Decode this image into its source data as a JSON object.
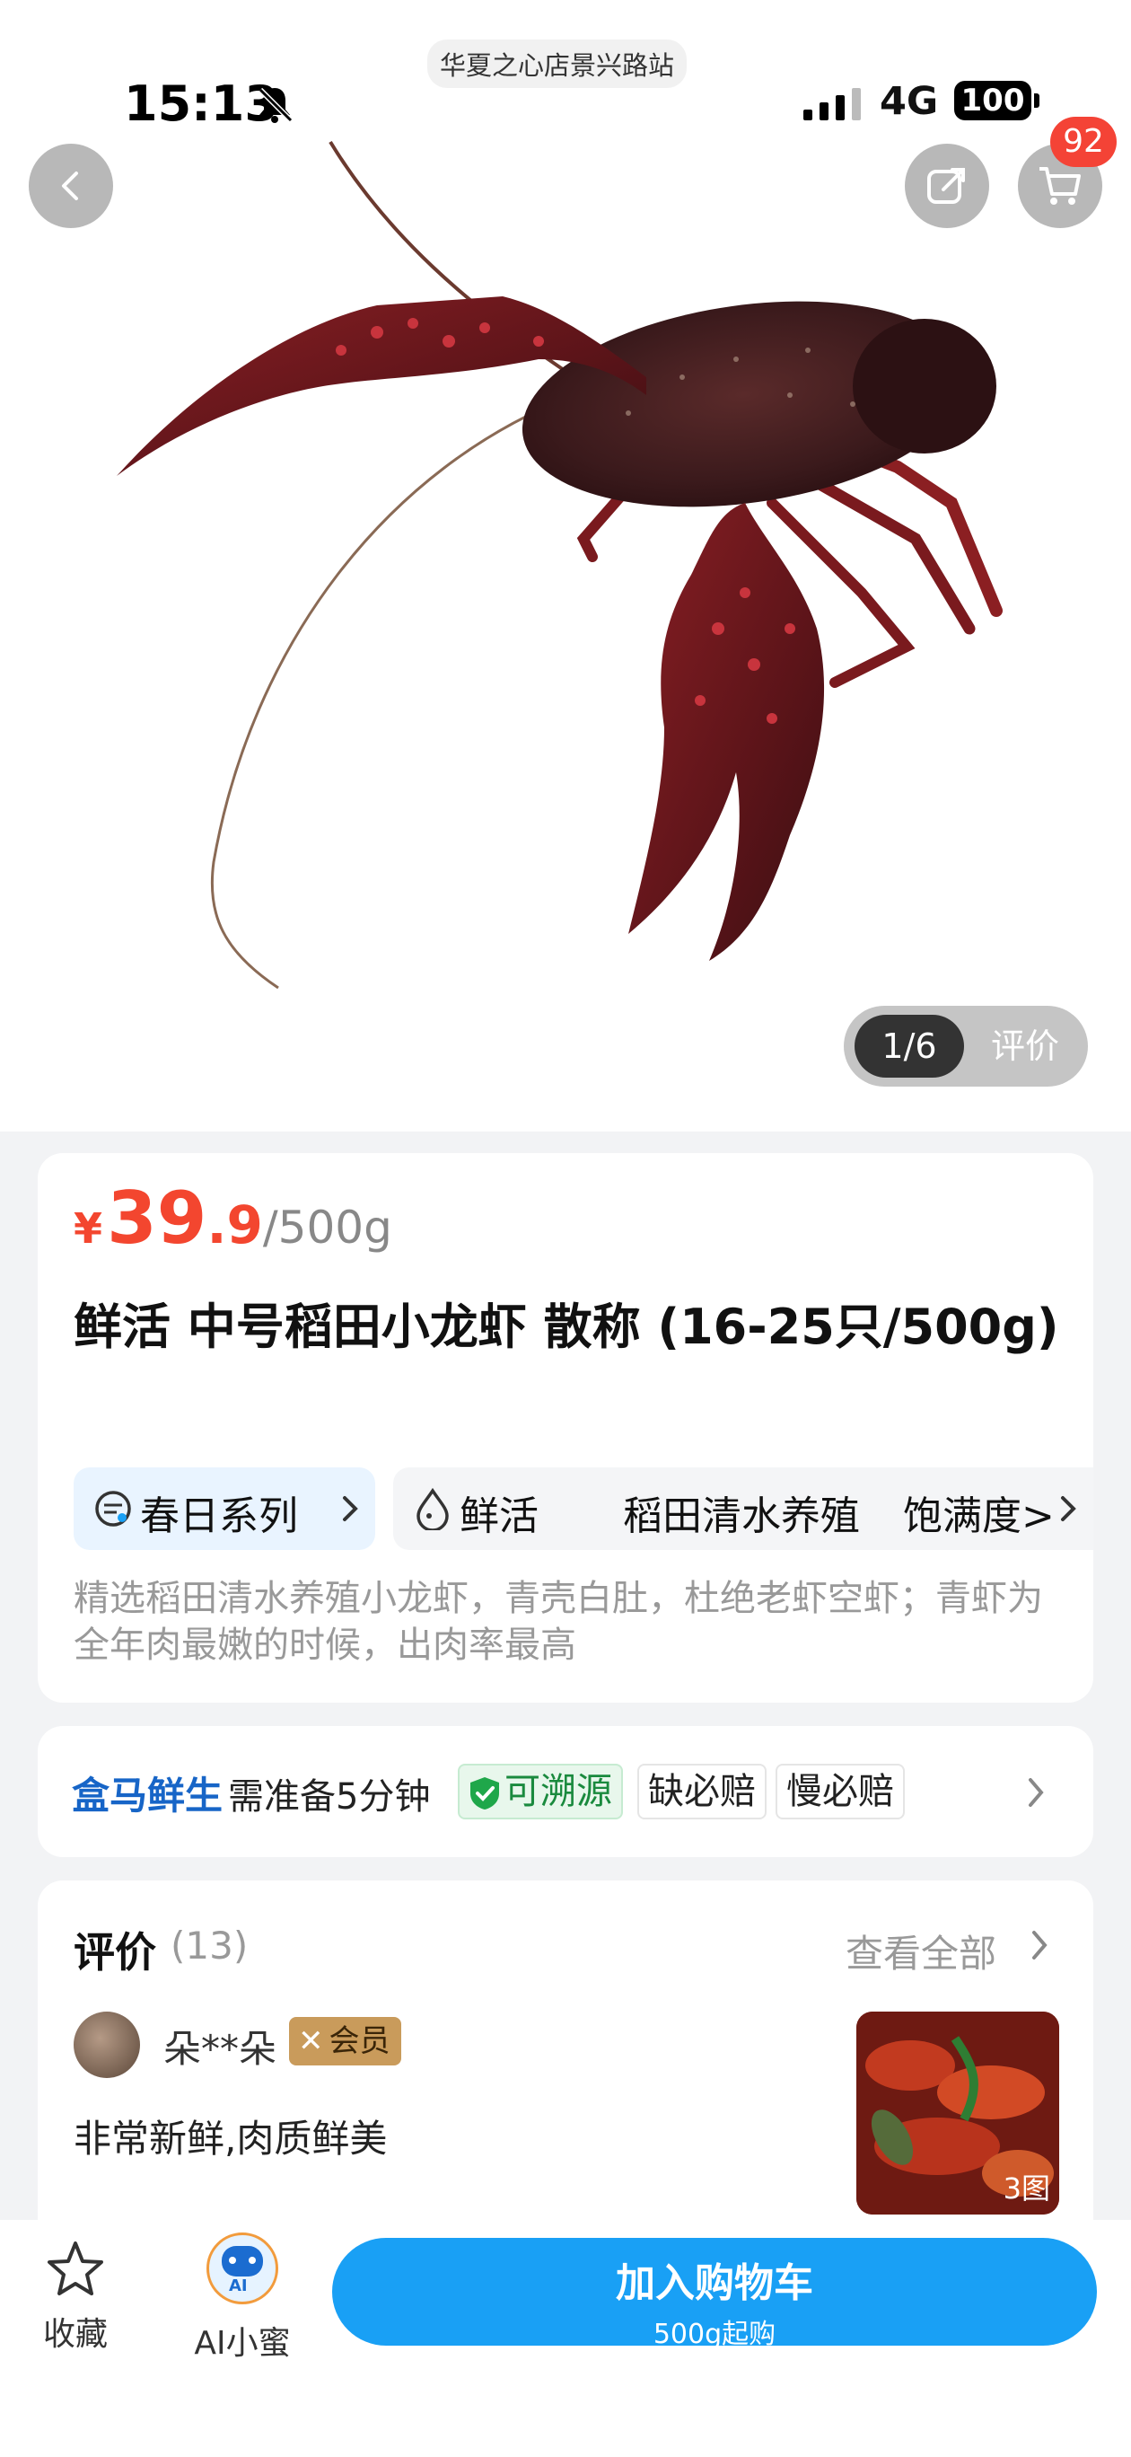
{
  "status_bar": {
    "time": "15:13",
    "network": "4G",
    "battery": "100"
  },
  "store": {
    "name": "华夏之心店景兴路站"
  },
  "header": {
    "cart_count": "92"
  },
  "gallery": {
    "index": "1/6",
    "reviews_link": "评价"
  },
  "product": {
    "price_symbol": "¥",
    "price_int": "39",
    "price_dec": ".9",
    "price_unit": "/500g",
    "title": "鲜活 中号稻田小龙虾 散称 (16-25只/500g)",
    "series_tag": "春日系列",
    "attributes": [
      "鲜活",
      "稻田清水养殖",
      "饱满度>"
    ],
    "description": "精选稻田清水养殖小龙虾，青壳白肚，杜绝老虾空虾；青虾为全年肉最嫩的时候，出肉率最高"
  },
  "service": {
    "brand": "盒马鲜生",
    "prep": "需准备5分钟",
    "traceable": "可溯源",
    "badges": [
      "缺必赔",
      "慢必赔"
    ]
  },
  "reviews": {
    "title": "评价",
    "count": "(13)",
    "view_all": "查看全部",
    "items": [
      {
        "user": "朵**朵",
        "member_badge": "会员",
        "text": "非常新鲜,肉质鲜美",
        "photo_count": "3图"
      }
    ]
  },
  "bottom_bar": {
    "favorite_label": "收藏",
    "ai_label": "AI小蜜",
    "ai_badge": "AI",
    "cta_label": "加入购物车",
    "cta_sub": "500g起购"
  },
  "colors": {
    "accent": "#19a0f5",
    "price": "#f3462f",
    "badge": "#f44336",
    "trace_green": "#1fa74a"
  }
}
